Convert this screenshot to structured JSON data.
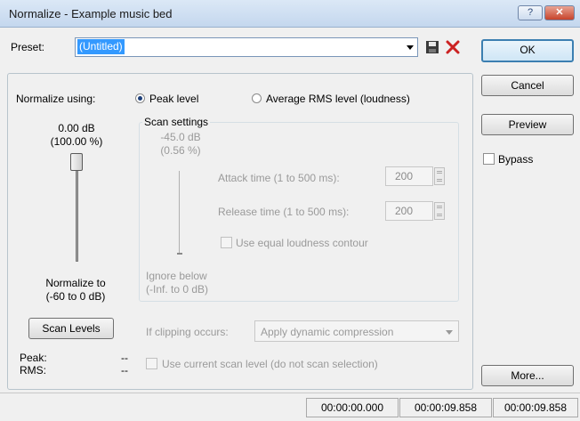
{
  "window": {
    "title": "Normalize - Example music bed",
    "help_btn": "?",
    "close_btn": "✕"
  },
  "preset": {
    "label": "Preset:",
    "value": "(Untitled)"
  },
  "buttons": {
    "ok": "OK",
    "cancel": "Cancel",
    "preview": "Preview",
    "more": "More...",
    "scan_levels": "Scan Levels"
  },
  "bypass": {
    "label": "Bypass",
    "checked": false
  },
  "normalize": {
    "using_label": "Normalize using:",
    "option_peak": "Peak level",
    "option_rms": "Average RMS level (loudness)",
    "selected": "peak",
    "db_value": "0.00 dB",
    "pct_value": "(100.00 %)",
    "level_fraction": 1.0,
    "to_label_1": "Normalize to",
    "to_label_2": "(-60 to 0 dB)"
  },
  "scan_settings": {
    "title": "Scan settings",
    "db_value": "-45.0 dB",
    "pct_value": "(0.56 %)",
    "level_fraction": 0.0,
    "attack_label": "Attack time (1 to 500 ms):",
    "attack_value": "200",
    "release_label": "Release time (1 to 500 ms):",
    "release_value": "200",
    "equal_loudness_label": "Use equal loudness contour",
    "ignore_label_1": "Ignore below",
    "ignore_label_2": "(-Inf. to 0 dB)"
  },
  "clipping": {
    "label": "If clipping occurs:",
    "value": "Apply dynamic compression"
  },
  "use_current_scan_label": "Use current scan level (do not scan selection)",
  "levels": {
    "peak_label": "Peak:",
    "peak_value": "--",
    "rms_label": "RMS:",
    "rms_value": "--"
  },
  "status": {
    "start": "00:00:00.000",
    "end": "00:00:09.858",
    "length": "00:00:09.858"
  },
  "colors": {
    "accent": "#3399ff",
    "delete_icon": "#cc2222",
    "titlebar": "#c4d7ee"
  },
  "icons": {
    "save": "floppy-disk",
    "delete": "red-x",
    "dropdown": "triangle-down"
  }
}
